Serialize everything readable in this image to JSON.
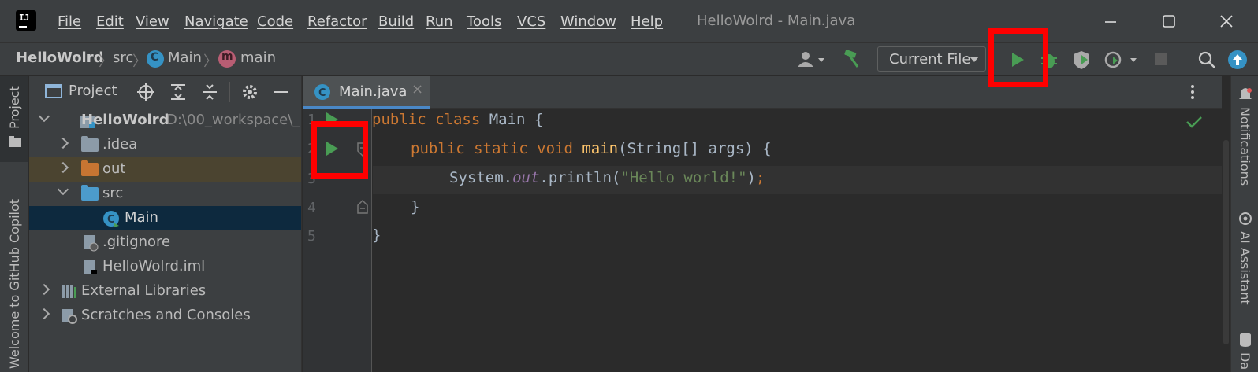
{
  "app": {
    "logo_text": "IJ",
    "window_title": "HelloWolrd - Main.java"
  },
  "menu": [
    "File",
    "Edit",
    "View",
    "Navigate",
    "Code",
    "Refactor",
    "Build",
    "Run",
    "Tools",
    "VCS",
    "Window",
    "Help"
  ],
  "breadcrumb": {
    "project": "HelloWolrd",
    "folder": "src",
    "class": "Main",
    "method": "main"
  },
  "toolbar": {
    "run_config": "Current File"
  },
  "left_stripe": {
    "project_tab": "Project",
    "copilot_tab": "Welcome to GitHub Copilot"
  },
  "project_panel": {
    "title": "Project",
    "tree": [
      {
        "label": "HelloWolrd",
        "path": "D:\\00_workspace\\_"
      },
      {
        "label": ".idea"
      },
      {
        "label": "out"
      },
      {
        "label": "src"
      },
      {
        "label": "Main"
      },
      {
        "label": ".gitignore"
      },
      {
        "label": "HelloWolrd.iml"
      },
      {
        "label": "External Libraries"
      },
      {
        "label": "Scratches and Consoles"
      }
    ]
  },
  "editor": {
    "tab_label": "Main.java",
    "line_numbers": [
      "1",
      "2",
      "3",
      "4",
      "5"
    ],
    "code": {
      "l1_kw": "public class ",
      "l1_rest": "Main {",
      "l2_kw": "public static void ",
      "l2_fn": "main",
      "l2_rest": "(String[] args) {",
      "l3_a": "System.",
      "l3_b": "out",
      "l3_c": ".println(",
      "l3_str": "\"Hello world!\"",
      "l3_end": ")",
      "l3_semi": ";",
      "l4": "}",
      "l5": "}"
    }
  },
  "right_stripe": {
    "notifications": "Notifications",
    "ai_assistant": "AI Assistant",
    "db": "Da"
  },
  "colors": {
    "accent_red": "#ff0000",
    "run_green": "#499c54"
  }
}
